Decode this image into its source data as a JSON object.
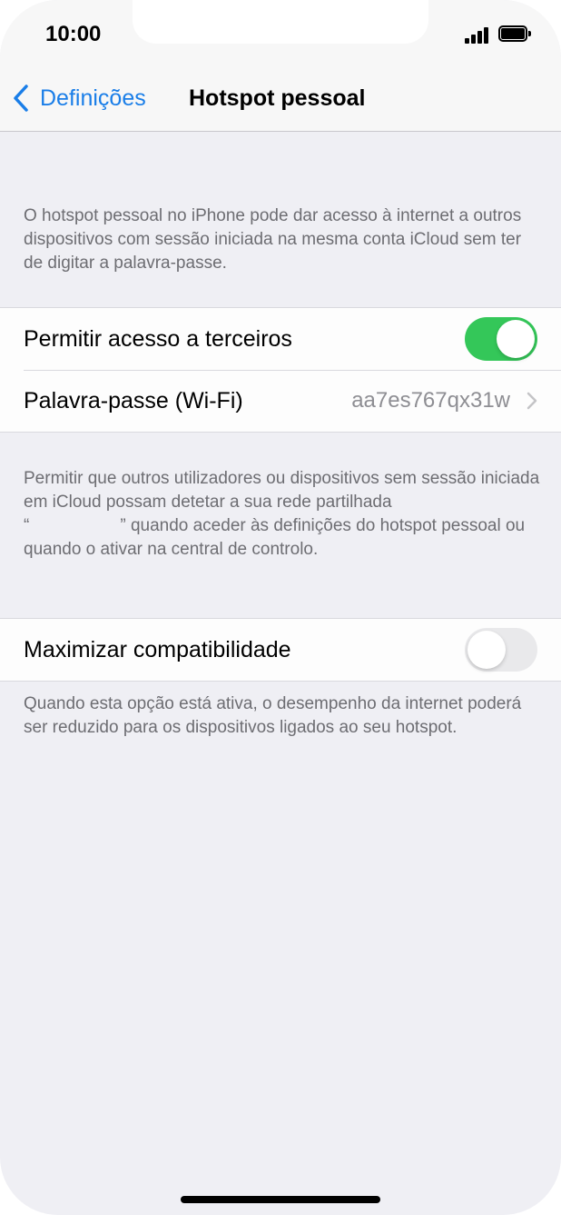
{
  "status_bar": {
    "time": "10:00",
    "signal_icon": "cellular-signal-icon",
    "battery_icon": "battery-icon"
  },
  "nav": {
    "back_label": "Definições",
    "title": "Hotspot pessoal",
    "back_icon": "chevron-left-icon"
  },
  "intro_note": "O hotspot pessoal no iPhone pode dar acesso à internet a outros dispositivos com sessão iniciada na mesma conta iCloud sem ter de digitar a palavra-passe.",
  "access_group": {
    "allow_label": "Permitir acesso a terceiros",
    "allow_enabled": true,
    "password_label": "Palavra-passe (Wi-Fi)",
    "password_value": "aa7es767qx31w"
  },
  "access_note": {
    "line_before": "Permitir que outros utilizadores ou dispositivos sem sessão iniciada em iCloud possam detetar a sua rede partilhada",
    "quote_open": "“",
    "quote_close": "”",
    "line_after": "quando aceder às definições do hotspot pessoal ou quando o ativar na central de controlo."
  },
  "compat_group": {
    "label": "Maximizar compatibilidade",
    "enabled": false
  },
  "compat_note": "Quando esta opção está ativa, o desempenho da internet poderá ser reduzido para os dispositivos ligados ao seu hotspot.",
  "colors": {
    "accent": "#1a7ee8",
    "toggle_on": "#34c759",
    "background": "#efeff4"
  }
}
